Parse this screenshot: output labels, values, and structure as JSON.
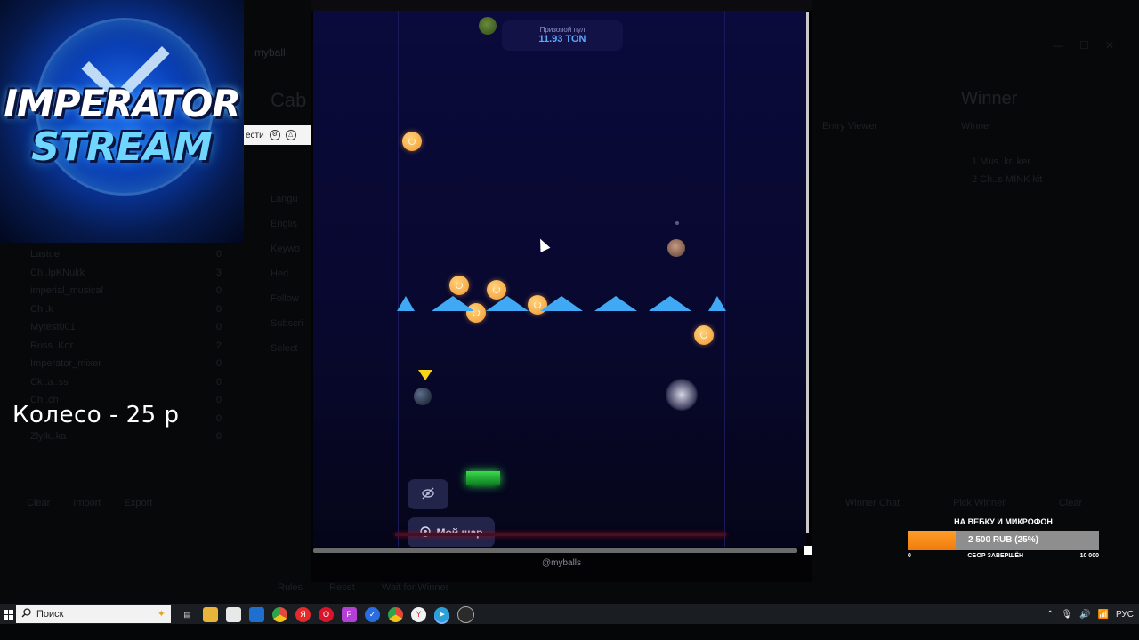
{
  "stream": {
    "logo_line1": "IMPERATOR",
    "logo_line2": "STREAM",
    "wheel_caption": "Колесо - 25 р",
    "notif_text": "ести"
  },
  "background_app": {
    "title": "myball",
    "heading": "Cab",
    "list_items": [
      "Lastue",
      "Ch..lpKNukk",
      "imperial_musical",
      "Ch..k",
      "Mytest001",
      "Russ..Kor",
      "Imperator_mixer",
      "Ck..a..ss",
      "Ch..ch",
      "Ch..k",
      "Zlylk..ka"
    ],
    "list_counts": [
      "0",
      "3",
      "0",
      "0",
      "0",
      "2",
      "0",
      "0",
      "0",
      "0",
      "0"
    ],
    "left_buttons": [
      "Clear",
      "Import",
      "Export"
    ],
    "form_labels": [
      "Langu",
      "Englis",
      "",
      "Keywo",
      "Hed",
      "Follow",
      "",
      "Subscri",
      "",
      "Select"
    ],
    "right_heading": "Winner",
    "right_sub1": "Entry Viewer",
    "right_sub2": "Winner",
    "winner1": "1  Mus..kr..ker",
    "winner2": "2  Ch..s MINK kit",
    "right_buttons": [
      "Winner Chat",
      "Pick Winner",
      "Clear"
    ],
    "bottom_buttons": [
      "Rules",
      "Reset",
      "Wait for Winner"
    ]
  },
  "game": {
    "prize_label": "Призовой пул",
    "prize_value": "11.93 TON",
    "hide_icon": "eye-off-icon",
    "my_ball_label": "Мой шар",
    "handle": "@myballs"
  },
  "donation": {
    "title": "НА ВЕБКУ И МИКРОФОН",
    "amount_text": "2 500 RUB (25%)",
    "progress_percent": 25,
    "min_label": "0",
    "status_label": "СБОР ЗАВЕРШЁН",
    "max_label": "10 000"
  },
  "taskbar": {
    "search_placeholder": "Поиск",
    "language": "РУС",
    "apps": [
      "task-view-icon",
      "explorer-icon",
      "store-icon",
      "outlook-icon",
      "chrome-icon",
      "yandex-icon",
      "opera-icon",
      "phpstorm-icon",
      "vpn-icon",
      "chrome-alt-icon",
      "yandex-browser-icon",
      "telegram-icon",
      "obs-icon"
    ]
  },
  "colors": {
    "game_bg": "#0a0a3c",
    "spike": "#3fa9f5",
    "coin": "#f29a32",
    "donation_fill": "#f17b0c",
    "prize_value": "#5ea8ff"
  }
}
